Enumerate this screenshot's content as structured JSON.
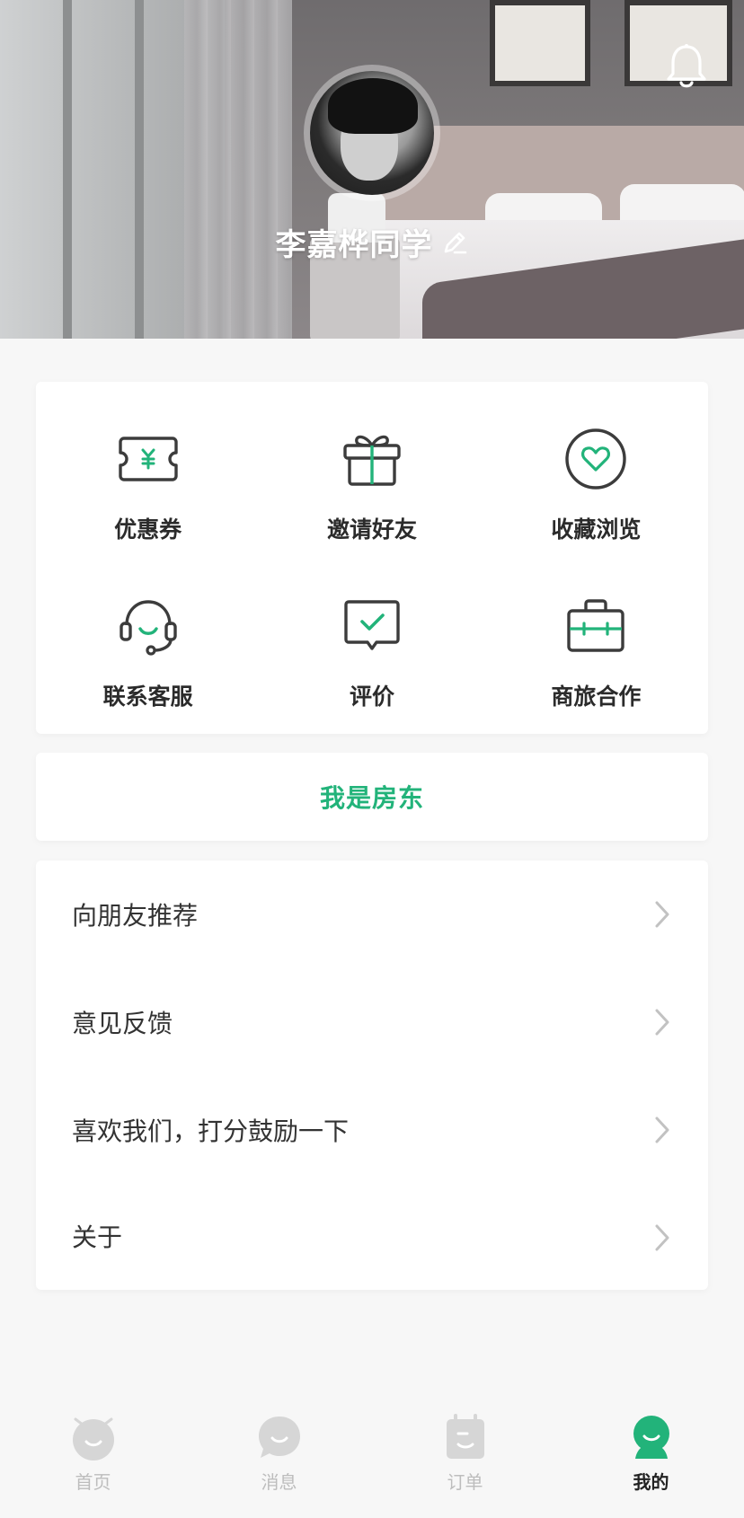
{
  "profile": {
    "name": "李嘉桦同学"
  },
  "quick_actions": [
    {
      "label": "优惠券",
      "icon": "coupon-icon"
    },
    {
      "label": "邀请好友",
      "icon": "gift-icon"
    },
    {
      "label": "收藏浏览",
      "icon": "heart-icon"
    },
    {
      "label": "联系客服",
      "icon": "headset-icon"
    },
    {
      "label": "评价",
      "icon": "review-icon"
    },
    {
      "label": "商旅合作",
      "icon": "briefcase-icon"
    }
  ],
  "landlord": {
    "label": "我是房东"
  },
  "menu": [
    {
      "label": "向朋友推荐"
    },
    {
      "label": "意见反馈"
    },
    {
      "label": "喜欢我们，打分鼓励一下"
    },
    {
      "label": "关于"
    }
  ],
  "tabbar": [
    {
      "label": "首页",
      "icon": "home-icon",
      "active": false
    },
    {
      "label": "消息",
      "icon": "message-icon",
      "active": false
    },
    {
      "label": "订单",
      "icon": "order-icon",
      "active": false
    },
    {
      "label": "我的",
      "icon": "profile-icon",
      "active": true
    }
  ],
  "colors": {
    "accent": "#22b37a",
    "icon_dark": "#3c3c3c",
    "tab_inactive": "#d6d6d6"
  }
}
